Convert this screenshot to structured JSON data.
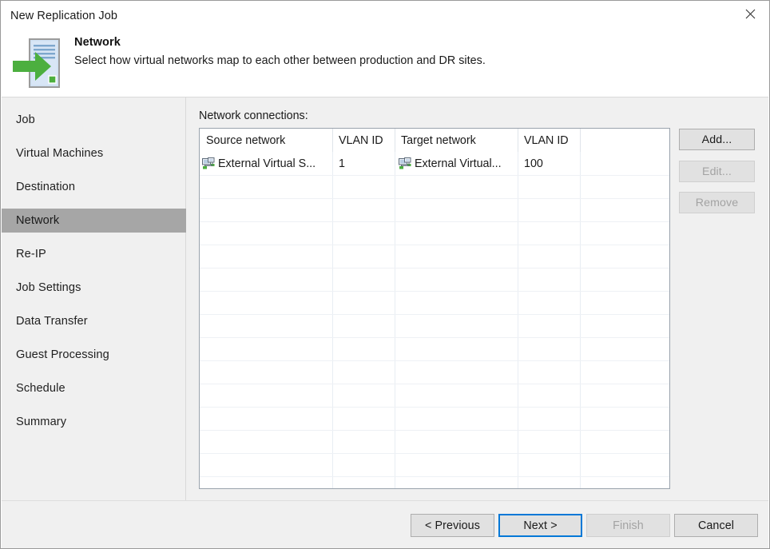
{
  "window": {
    "title": "New Replication Job",
    "close_icon": "close-icon"
  },
  "header": {
    "icon": "replication-server-arrow-icon",
    "title": "Network",
    "subtitle": "Select how virtual networks map to each other between production and DR sites."
  },
  "sidebar": {
    "items": [
      {
        "label": "Job",
        "selected": false
      },
      {
        "label": "Virtual Machines",
        "selected": false
      },
      {
        "label": "Destination",
        "selected": false
      },
      {
        "label": "Network",
        "selected": true
      },
      {
        "label": "Re-IP",
        "selected": false
      },
      {
        "label": "Job Settings",
        "selected": false
      },
      {
        "label": "Data Transfer",
        "selected": false
      },
      {
        "label": "Guest Processing",
        "selected": false
      },
      {
        "label": "Schedule",
        "selected": false
      },
      {
        "label": "Summary",
        "selected": false
      }
    ],
    "selected_color": "#a6a6a6",
    "background_color": "#f0f0f0"
  },
  "main": {
    "list_label": "Network connections:",
    "table": {
      "columns": [
        "Source network",
        "VLAN ID",
        "Target network",
        "VLAN ID",
        ""
      ],
      "rows": [
        {
          "source_network": "External Virtual S...",
          "source_vlan": "1",
          "target_network": "External Virtual...",
          "target_vlan": "100",
          "spare": "",
          "source_icon": "network-adapter-icon",
          "target_icon": "network-adapter-icon"
        }
      ],
      "empty_row_count": 13
    },
    "side_buttons": [
      {
        "label": "Add...",
        "enabled": true
      },
      {
        "label": "Edit...",
        "enabled": false
      },
      {
        "label": "Remove",
        "enabled": false
      }
    ]
  },
  "footer": {
    "buttons": [
      {
        "label": "< Previous",
        "enabled": true,
        "primary": false
      },
      {
        "label": "Next >",
        "enabled": true,
        "primary": true
      },
      {
        "label": "Finish",
        "enabled": false,
        "primary": false
      },
      {
        "label": "Cancel",
        "enabled": true,
        "primary": false
      }
    ]
  },
  "colors": {
    "accent": "#0078d7",
    "green": "#4caf3f",
    "window_bg": "#f0f0f0",
    "table_border": "#9aa3ad"
  }
}
